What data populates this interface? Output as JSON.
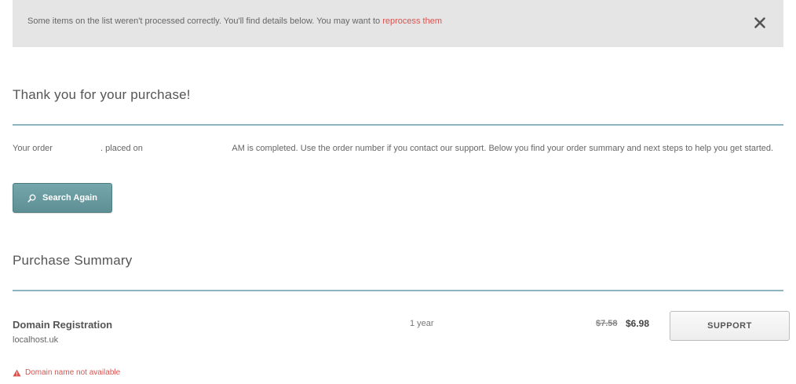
{
  "alert": {
    "message": "Some items on the list weren't processed correctly. You'll find details below. You may want to ",
    "link_text": "reprocess them",
    "close_icon": "close-icon"
  },
  "confirmation": {
    "title": "Thank you for your purchase!",
    "text_before_order": "Your order ",
    "text_placed_on": ". placed on ",
    "text_after_date": " AM is completed. Use the order number if you contact our support. Below you find your order summary and next steps to help you get started."
  },
  "search_button": {
    "label": "Search Again",
    "icon": "search-icon"
  },
  "summary": {
    "title": "Purchase Summary",
    "items": [
      {
        "name": "Domain Registration",
        "domain": "localhost.uk",
        "term": "1 year",
        "price_old": "$7.58",
        "price_new": "$6.98",
        "support_label": "SUPPORT",
        "error": "Domain name not available"
      }
    ]
  },
  "colors": {
    "accent": "#8eb4c0",
    "button_teal": "#6a9ba0",
    "error_red": "#d9534f",
    "alert_bg": "#e5e5e5"
  }
}
